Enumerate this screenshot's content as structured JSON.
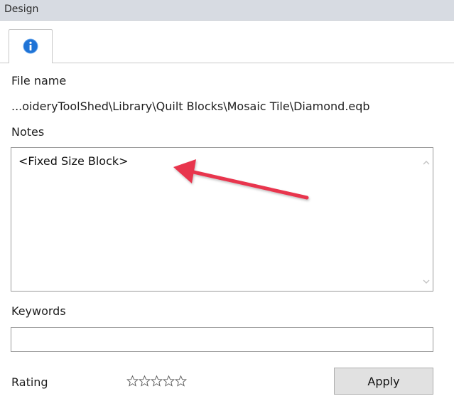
{
  "panel": {
    "title": "Design"
  },
  "tab": {
    "icon": "info-icon",
    "accent": "#1e73d6"
  },
  "file": {
    "label": "File name",
    "path": "...oideryToolShed\\Library\\Quilt Blocks\\Mosaic Tile\\Diamond.eqb"
  },
  "notes": {
    "label": "Notes",
    "value": "<Fixed Size Block>"
  },
  "keywords": {
    "label": "Keywords",
    "value": ""
  },
  "rating": {
    "label": "Rating",
    "stars_total": 5,
    "stars_filled": 0
  },
  "buttons": {
    "apply_label": "Apply"
  },
  "annotation": {
    "arrow_color": "#e8344e",
    "icon": "arrow-pointer-icon"
  }
}
